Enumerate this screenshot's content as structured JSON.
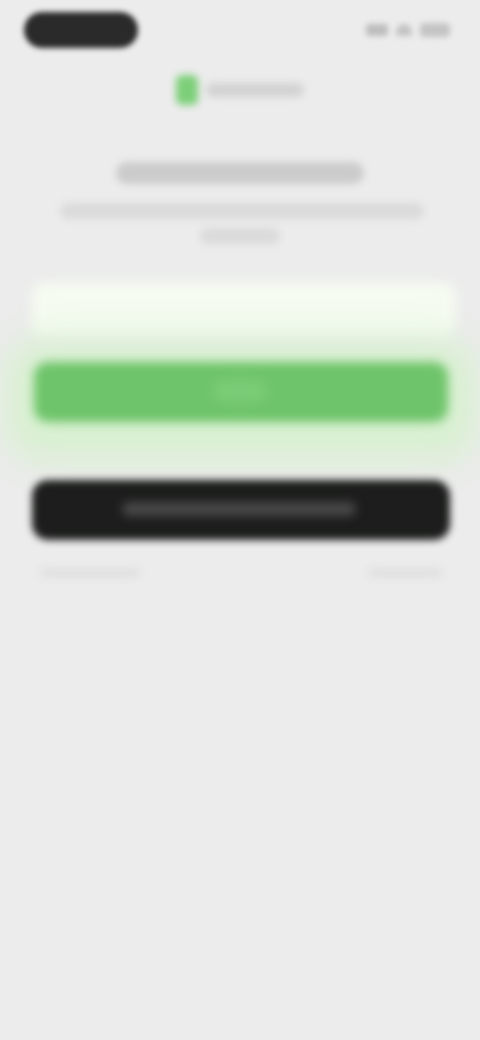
{
  "colors": {
    "background": "#ececec",
    "accent": "#6ec46a",
    "dark_button": "#1c1d1c",
    "input_bg": "#f5fbf1"
  },
  "status_bar": {
    "icons": [
      "signal-icon",
      "wifi-icon",
      "battery-icon"
    ]
  },
  "logo": {
    "icon": "brand-logo-icon"
  },
  "form": {
    "input_value": ""
  }
}
